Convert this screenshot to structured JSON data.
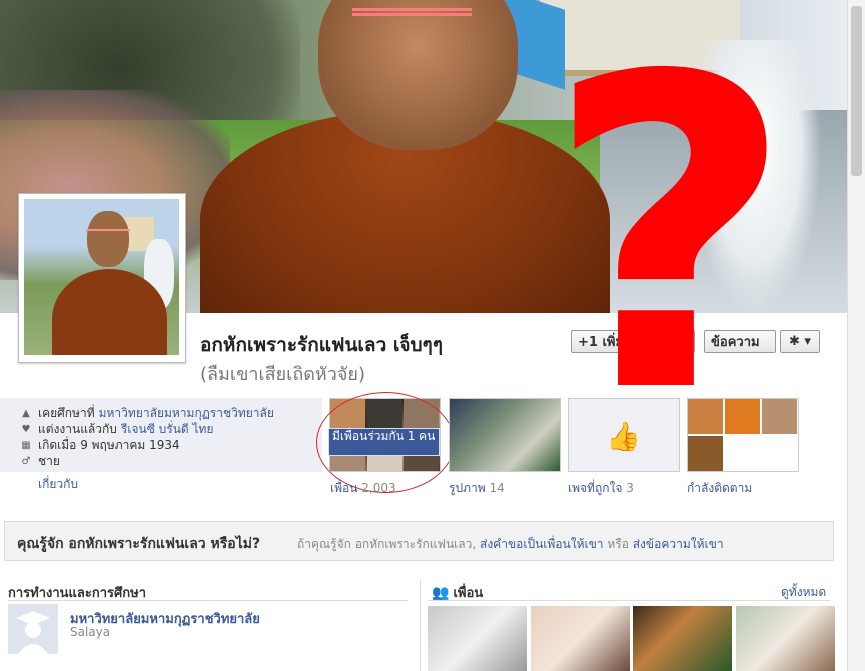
{
  "profile": {
    "name": "อกหักเพราะรักแฟนเลว เจ็บๆๆ",
    "alternate_name": "(ลืมเขาเสียเถิดหัวจัย)"
  },
  "actions": {
    "add_friend": "+1 เพิ่มเป็นเพื่อน",
    "message": "ข้อความ",
    "gear": "✱ ▾"
  },
  "info": {
    "studied_prefix": "เคยศึกษาที่",
    "studied_link": "มหาวิทยาลัยมหามกุฏราชวิทยาลัย",
    "married_prefix": "แต่งงานแล้วกับ",
    "married_link": "รีเจนซี บรั่นดี ไทย",
    "born": "เกิดเมื่อ 9 พฤษภาคม 1934",
    "gender": "ชาย",
    "about_link": "เกี่ยวกับ"
  },
  "tiles": {
    "mutual_badge": "มีเพื่อนร่วมกัน 1 คน",
    "friends_label": "เพื่อน",
    "friends_count": "2,003",
    "photos_label": "รูปภาพ",
    "photos_count": "14",
    "likes_label": "เพจที่ถูกใจ",
    "likes_count": "3",
    "following_label": "กำลังติดตาม"
  },
  "know": {
    "title": "คุณรู้จัก อกหักเพราะรักแฟนเลว หรือไม่?",
    "text_prefix": "ถ้าคุณรู้จัก อกหักเพราะรักแฟนเลว,",
    "send_request": "ส่งคำขอเป็นเพื่อนให้เขา",
    "or": "หรือ",
    "send_message": "ส่งข้อความให้เขา"
  },
  "work_edu": {
    "heading": "การทำงานและการศึกษา",
    "school": "มหาวิทยาลัยมหามกุฏราชวิทยาลัย",
    "location": "Salaya"
  },
  "friends_section": {
    "heading": "เพื่อน",
    "see_all": "ดูทั้งหมด"
  },
  "overlay": {
    "question_mark": "?"
  },
  "colors": {
    "link": "#3b5998",
    "overlay_red": "#ff0000",
    "robe": "#7d330d"
  }
}
